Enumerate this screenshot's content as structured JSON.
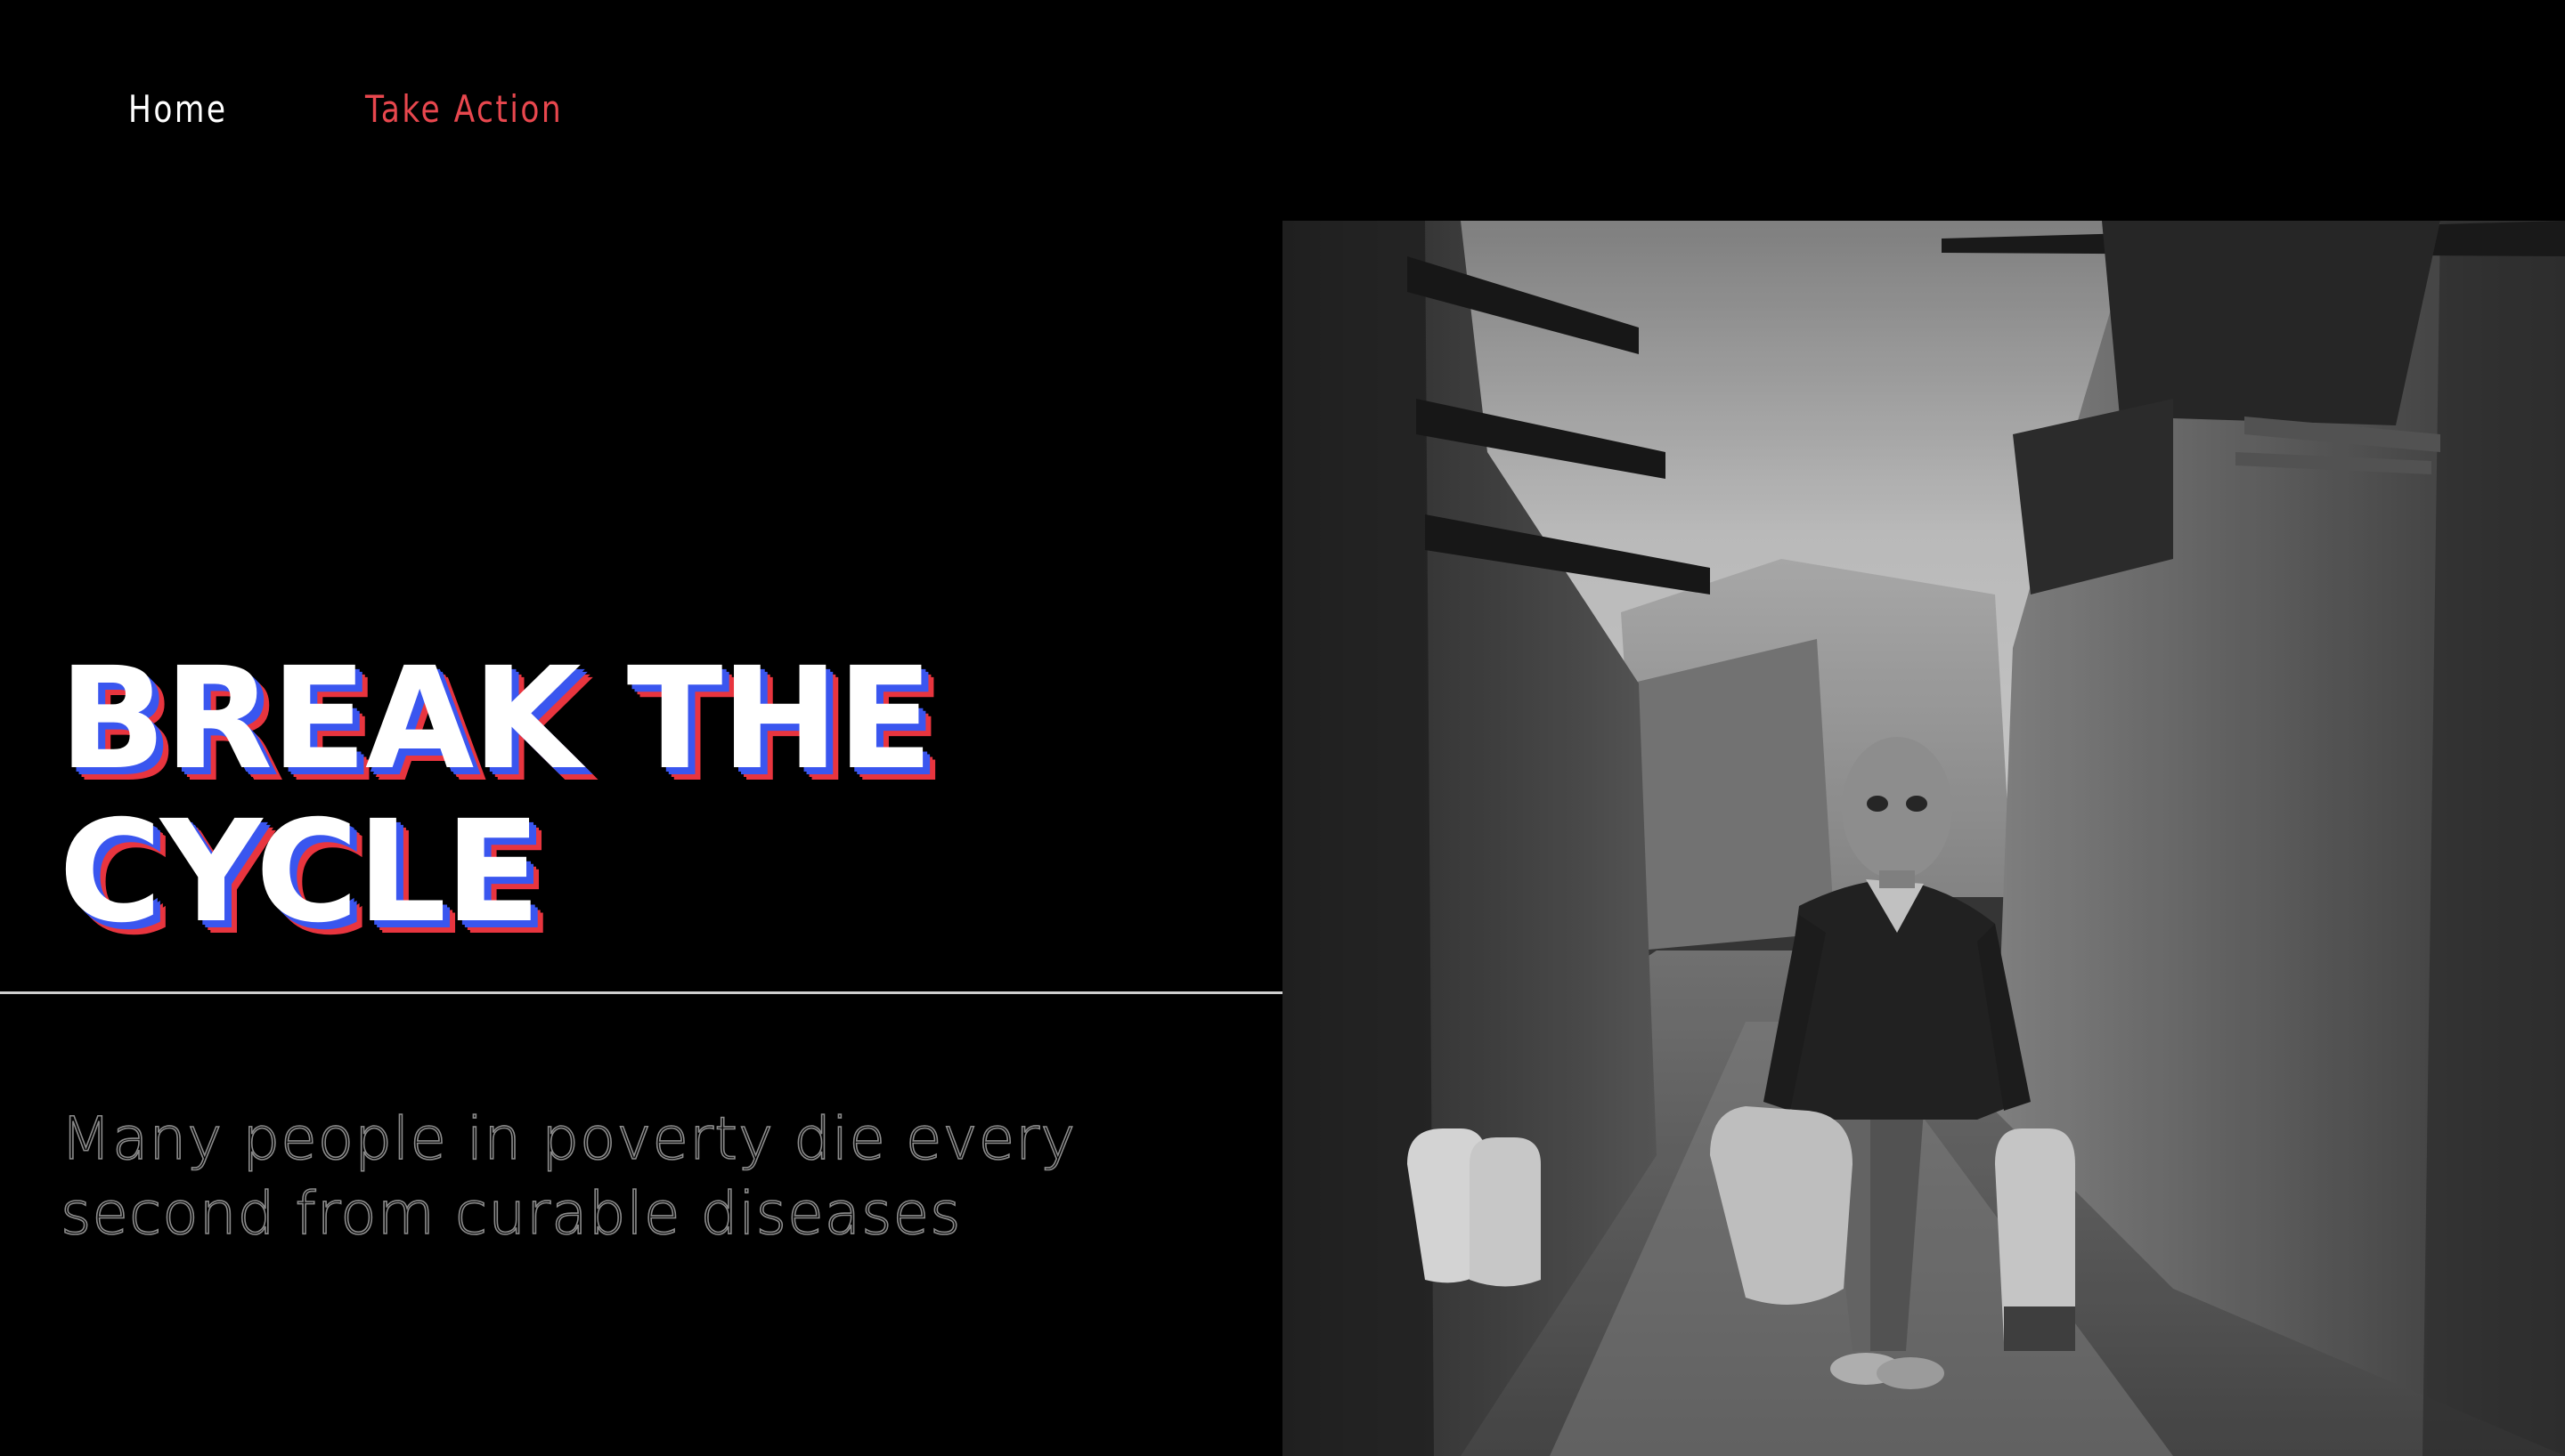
{
  "nav": {
    "home_label": "Home",
    "take_action_label": "Take Action"
  },
  "hero": {
    "headline_line1": "BREAK THE",
    "headline_line2": "CYCLE",
    "subtitle_line1": "Many people in poverty die every",
    "subtitle_line2": "second from curable diseases"
  },
  "colors": {
    "background": "#000000",
    "accent_red": "#e8474e",
    "shadow_blue": "#3a56ef",
    "shadow_red": "#e8353f",
    "divider": "#cfcfcf",
    "subtitle_outline": "#8c8c8c"
  },
  "photo": {
    "style": "black-and-white"
  }
}
